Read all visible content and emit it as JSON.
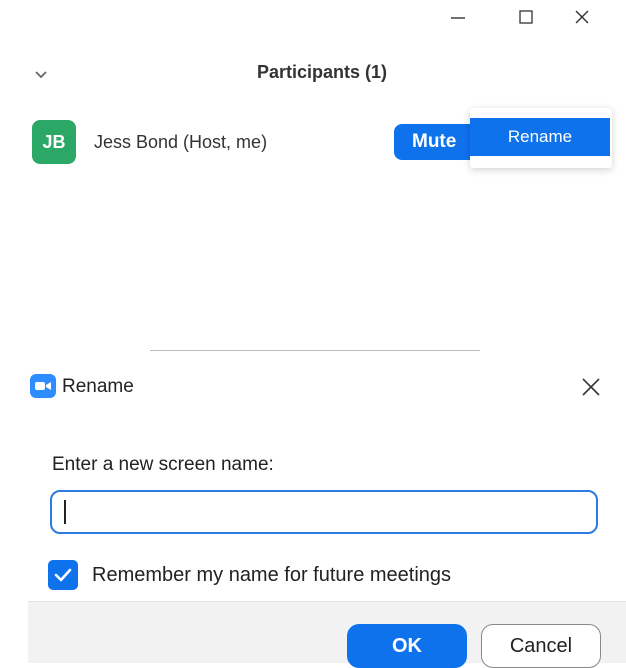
{
  "participants_window": {
    "title": "Participants (1)",
    "participant": {
      "initials": "JB",
      "avatar_color": "#2ca866",
      "name": "Jess Bond (Host, me)",
      "mute_label": "Mute"
    },
    "context_menu": {
      "items": [
        {
          "label": "Rename"
        }
      ]
    }
  },
  "rename_dialog": {
    "title": "Rename",
    "field_label": "Enter a new screen name:",
    "input_value": "",
    "remember_checked": true,
    "remember_label": "Remember my name for future meetings",
    "ok_label": "OK",
    "cancel_label": "Cancel"
  },
  "colors": {
    "accent": "#0e72ed",
    "zoom_logo": "#2d8cff",
    "input_border": "#2d7de0"
  }
}
